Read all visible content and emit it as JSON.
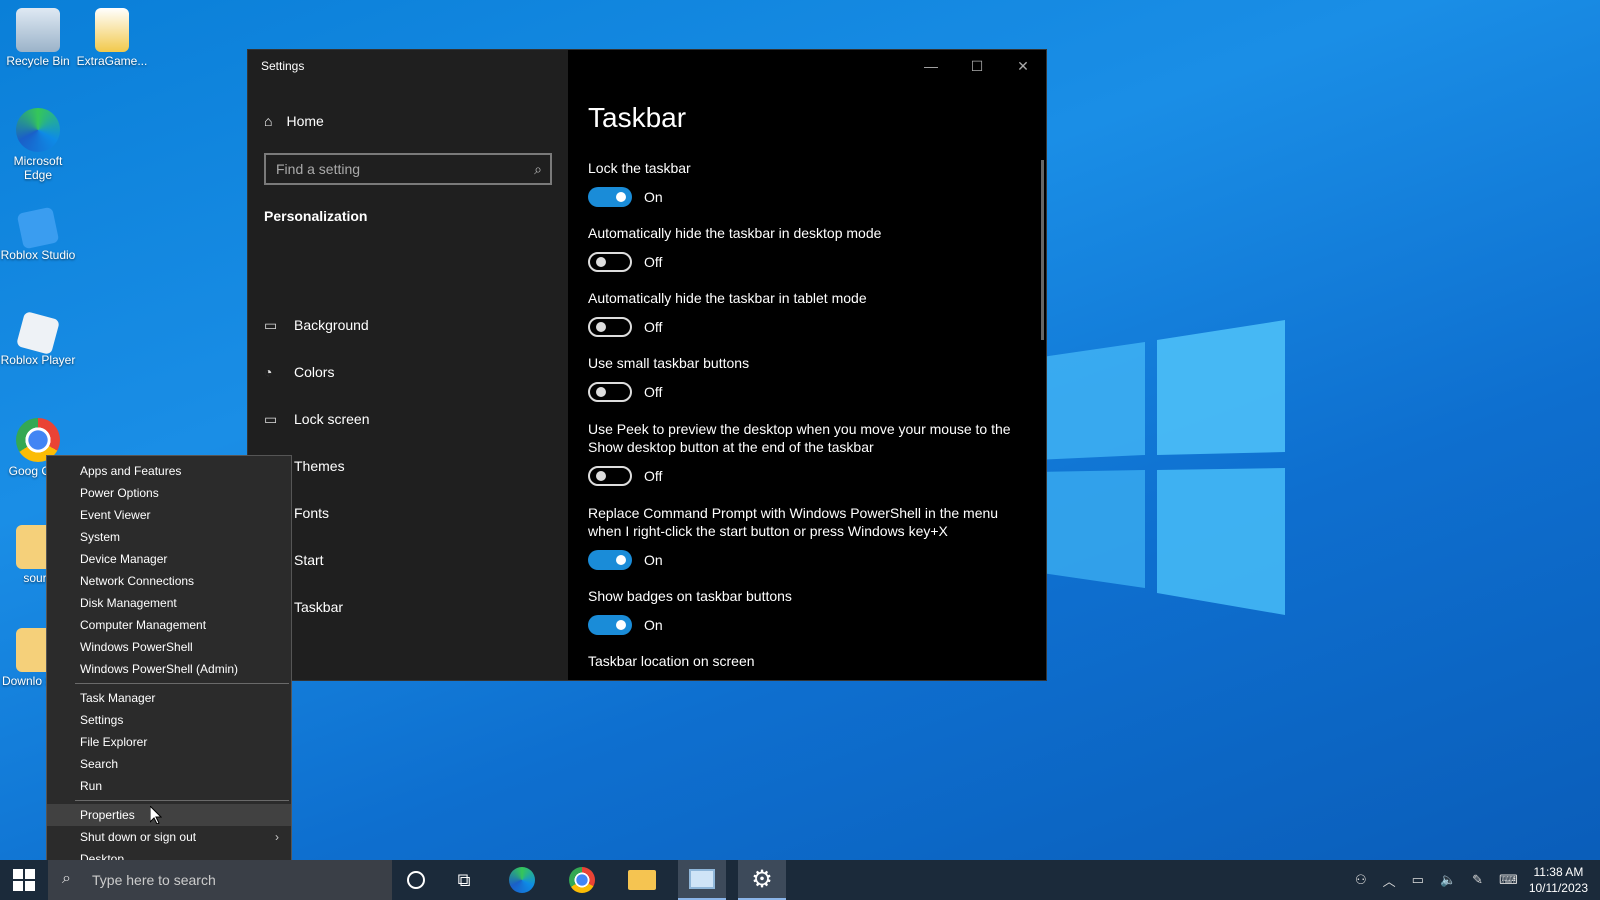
{
  "desktop": {
    "icons": [
      {
        "label": "Recycle Bin",
        "icon": "recycle-bin-icon"
      },
      {
        "label": "ExtraGame...",
        "icon": "file-icon"
      },
      {
        "label": "Microsoft Edge",
        "icon": "edge-icon"
      },
      {
        "label": "Roblox Studio",
        "icon": "roblox-studio-icon"
      },
      {
        "label": "Roblox Player",
        "icon": "roblox-player-icon"
      },
      {
        "label": "Goog Chro",
        "icon": "chrome-icon"
      },
      {
        "label": "sourc",
        "icon": "folder-icon"
      },
      {
        "label": "Downlo Short",
        "icon": "folder-icon"
      }
    ]
  },
  "settings": {
    "window_title": "Settings",
    "home_label": "Home",
    "search_placeholder": "Find a setting",
    "section_title": "Personalization",
    "nav": [
      {
        "label": "Background",
        "icon": "picture-icon"
      },
      {
        "label": "Colors",
        "icon": "palette-icon"
      },
      {
        "label": "Lock screen",
        "icon": "lock-screen-icon"
      },
      {
        "label": "Themes",
        "icon": "themes-icon"
      },
      {
        "label": "Fonts",
        "icon": "fonts-icon"
      },
      {
        "label": "Start",
        "icon": "start-icon"
      },
      {
        "label": "Taskbar",
        "icon": "taskbar-icon"
      }
    ],
    "page_title": "Taskbar",
    "options": [
      {
        "label": "Lock the taskbar",
        "state": "On"
      },
      {
        "label": "Automatically hide the taskbar in desktop mode",
        "state": "Off"
      },
      {
        "label": "Automatically hide the taskbar in tablet mode",
        "state": "Off"
      },
      {
        "label": "Use small taskbar buttons",
        "state": "Off"
      },
      {
        "label": "Use Peek to preview the desktop when you move your mouse to the Show desktop button at the end of the taskbar",
        "state": "Off"
      },
      {
        "label": "Replace Command Prompt with Windows PowerShell in the menu when I right-click the start button or press Windows key+X",
        "state": "On"
      },
      {
        "label": "Show badges on taskbar buttons",
        "state": "On"
      }
    ],
    "location_label": "Taskbar location on screen"
  },
  "context_menu": {
    "group1": [
      "Apps and Features",
      "Power Options",
      "Event Viewer",
      "System",
      "Device Manager",
      "Network Connections",
      "Disk Management",
      "Computer Management",
      "Windows PowerShell",
      "Windows PowerShell (Admin)"
    ],
    "group2": [
      "Task Manager",
      "Settings",
      "File Explorer",
      "Search",
      "Run"
    ],
    "group3": [
      "Properties",
      "Shut down or sign out",
      "Desktop"
    ],
    "highlighted": "Properties"
  },
  "taskbar": {
    "search_placeholder": "Type here to search",
    "time": "11:38 AM",
    "date": "10/11/2023",
    "apps": [
      "cortana-icon",
      "task-view-icon",
      "edge-icon",
      "chrome-icon",
      "file-explorer-icon",
      "control-panel-icon",
      "settings-gear-icon"
    ]
  },
  "colors": {
    "accent": "#1a8cd8",
    "taskbar": "#1b2a3a",
    "desktop": "#0a7fd8"
  }
}
